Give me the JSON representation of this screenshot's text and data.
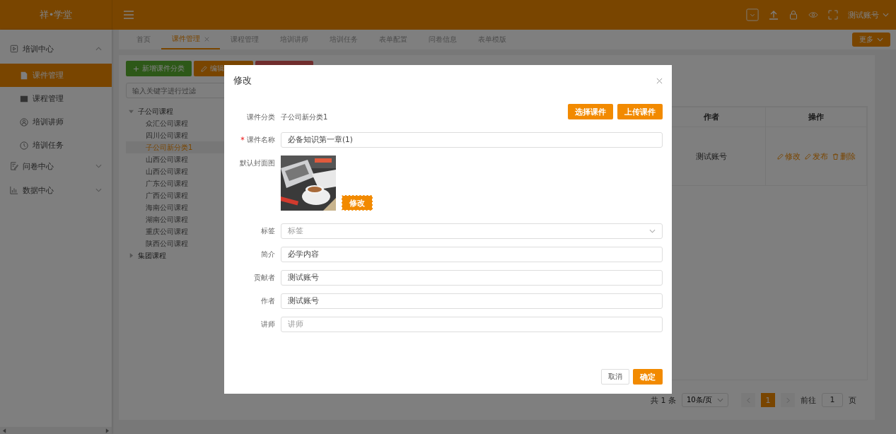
{
  "app": {
    "logo": "祥•学堂",
    "user": "测试账号"
  },
  "sidebar": [
    {
      "label": "培训中心",
      "expanded": true,
      "children": [
        {
          "label": "课件管理",
          "selected": true
        },
        {
          "label": "课程管理",
          "selected": false
        },
        {
          "label": "培训讲师",
          "selected": false
        },
        {
          "label": "培训任务",
          "selected": false
        }
      ]
    },
    {
      "label": "问卷中心",
      "expanded": false
    },
    {
      "label": "数据中心",
      "expanded": false
    }
  ],
  "tabs": [
    {
      "label": "首页",
      "selected": false,
      "closable": false
    },
    {
      "label": "课件管理",
      "selected": true,
      "closable": true
    },
    {
      "label": "课程管理",
      "selected": false,
      "closable": false
    },
    {
      "label": "培训讲师",
      "selected": false,
      "closable": false
    },
    {
      "label": "培训任务",
      "selected": false,
      "closable": false
    },
    {
      "label": "表单配置",
      "selected": false,
      "closable": false
    },
    {
      "label": "问卷信息",
      "selected": false,
      "closable": false
    },
    {
      "label": "表单模版",
      "selected": false,
      "closable": false
    }
  ],
  "more_button": "更多",
  "toolbar": [
    {
      "kind": "add",
      "label": "新增课件分类"
    },
    {
      "kind": "edit",
      "label": "编辑"
    },
    {
      "kind": "delete"
    }
  ],
  "filter": {
    "placeholder": "输入关键字进行过滤"
  },
  "tree": [
    {
      "label": "子公司课程",
      "expanded": true,
      "children": [
        {
          "label": "众汇公司课程",
          "selected": false
        },
        {
          "label": "四川公司课程",
          "selected": false
        },
        {
          "label": "子公司新分类1",
          "selected": true
        },
        {
          "label": "山西公司课程",
          "selected": false
        },
        {
          "label": "山西公司课程",
          "selected": false
        },
        {
          "label": "广东公司课程",
          "selected": false
        },
        {
          "label": "广西公司课程",
          "selected": false
        },
        {
          "label": "海南公司课程",
          "selected": false
        },
        {
          "label": "湖南公司课程",
          "selected": false
        },
        {
          "label": "重庆公司课程",
          "selected": false
        },
        {
          "label": "陕西公司课程",
          "selected": false
        }
      ]
    },
    {
      "label": "集团课程",
      "expanded": false
    }
  ],
  "table": {
    "columns": [
      "作者",
      "操作"
    ],
    "rows": [
      {
        "author": "测试账号",
        "actions": [
          {
            "kind": "edit",
            "label": "修改"
          },
          {
            "kind": "edit",
            "label": "发布"
          },
          {
            "kind": "delete",
            "label": "删除"
          }
        ]
      }
    ]
  },
  "pagination": {
    "total": "共 1 条",
    "page_size": "10条/页",
    "pages": [
      {
        "label": "1",
        "selected": true
      }
    ],
    "goto_label": "前往",
    "goto_value": "1",
    "page_unit": "页"
  },
  "modal": {
    "title": "修改",
    "top_buttons": [
      "选择课件",
      "上传课件"
    ],
    "fields": [
      {
        "kind": "text",
        "label": "课件分类",
        "value": "子公司新分类1",
        "required": false
      },
      {
        "kind": "input",
        "label": "课件名称",
        "value": "必备知识第一章(1)",
        "required": true
      },
      {
        "label": "默认封面图",
        "button": "修改",
        "required": false
      },
      {
        "kind": "select",
        "label": "标签",
        "placeholder": "标签",
        "required": false
      },
      {
        "kind": "input",
        "label": "简介",
        "value": "必学内容",
        "required": false
      },
      {
        "kind": "input",
        "label": "贡献者",
        "value": "测试账号",
        "required": false
      },
      {
        "kind": "input",
        "label": "作者",
        "value": "测试账号",
        "required": false
      },
      {
        "kind": "input",
        "label": "讲师",
        "placeholder": "讲师",
        "required": false
      }
    ],
    "cancel": "取消",
    "confirm": "确定"
  }
}
